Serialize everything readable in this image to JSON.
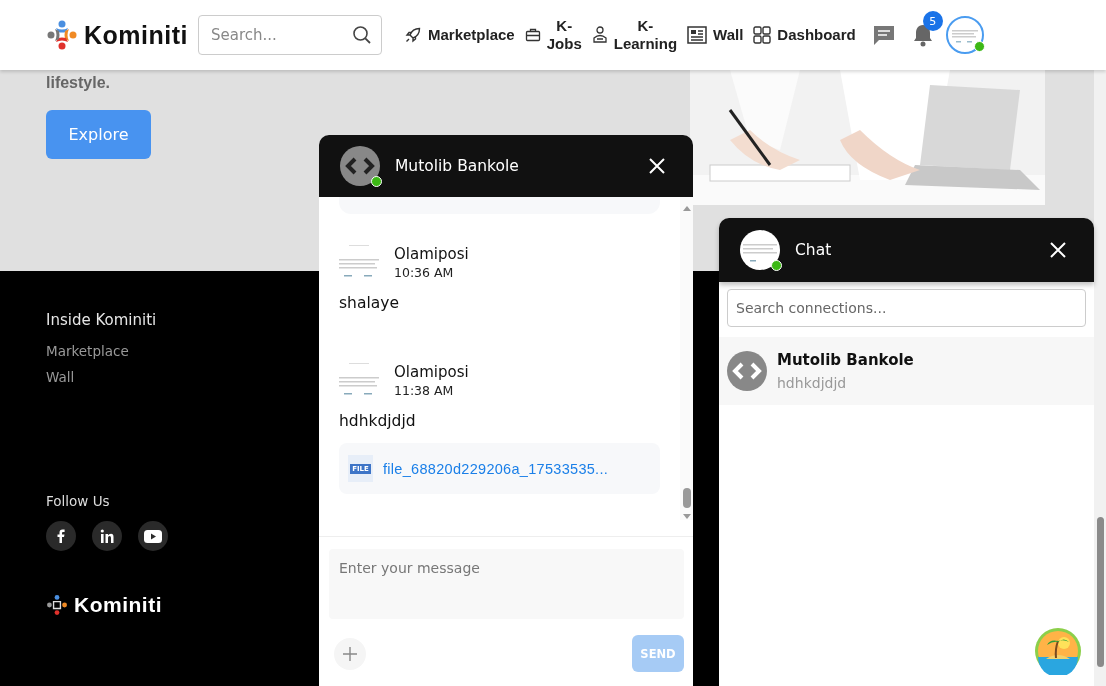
{
  "header": {
    "logo": "Kominiti",
    "search": {
      "placeholder": "Search..."
    },
    "nav": [
      {
        "label": "Marketplace"
      },
      {
        "label": "K-Jobs"
      },
      {
        "label": "K-Learning"
      },
      {
        "label": "Wall"
      },
      {
        "label": "Dashboard"
      }
    ],
    "notifications": {
      "count": "5"
    },
    "profile": {
      "online": true
    }
  },
  "hero": {
    "text": "lifestyle.",
    "button": "Explore"
  },
  "footer": {
    "section_title": "Inside Kominiti",
    "links": [
      "Marketplace",
      "Wall"
    ],
    "follow_title": "Follow Us",
    "social": [
      {
        "kind": "facebook"
      },
      {
        "kind": "linkedin"
      },
      {
        "kind": "youtube"
      }
    ],
    "logo": "Kominiti"
  },
  "conversation": {
    "name": "Mutolib Bankole",
    "online": true,
    "messages": [
      {
        "sender": "Olamiposi",
        "time": "10:36 AM",
        "text": "shalaye"
      },
      {
        "sender": "Olamiposi",
        "time": "11:38 AM",
        "text": "hdhkdjdjd",
        "attachment": {
          "type_label": "FILE",
          "name": "file_68820d229206a_17533535..."
        }
      }
    ],
    "input": {
      "placeholder": "Enter your message"
    },
    "send": "SEND"
  },
  "chat_list": {
    "title": "Chat",
    "online": true,
    "search": {
      "placeholder": "Search connections..."
    },
    "contacts": [
      {
        "name": "Mutolib Bankole",
        "preview": "hdhkdjdjd"
      }
    ]
  }
}
